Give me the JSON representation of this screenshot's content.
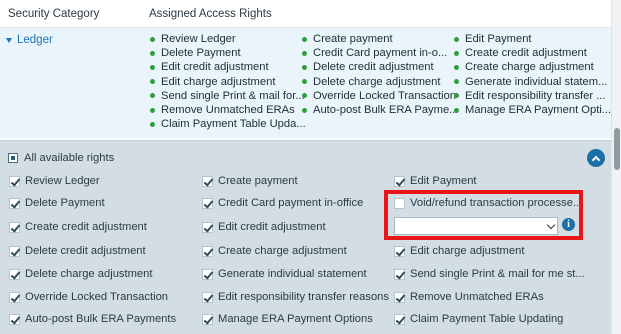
{
  "table": {
    "col_category": "Security Category",
    "col_rights": "Assigned Access Rights"
  },
  "category": {
    "label": "Ledger"
  },
  "assigned": {
    "col1": [
      "Review Ledger",
      "Delete Payment",
      "Edit credit adjustment",
      "Edit charge adjustment",
      "Send single Print & mail for...",
      "Remove Unmatched ERAs",
      "Claim Payment Table Upda..."
    ],
    "col2": [
      "Create payment",
      "Credit Card payment in-o...",
      "Delete credit adjustment",
      "Delete charge adjustment",
      "Override Locked Transaction",
      "Auto-post Bulk ERA Payme..."
    ],
    "col3": [
      "Edit Payment",
      "Create credit adjustment",
      "Create charge adjustment",
      "Generate individual statem...",
      "Edit responsibility transfer ...",
      "Manage ERA Payment Opti..."
    ]
  },
  "panel": {
    "all_rights_label": "All available rights",
    "rights": [
      {
        "label": "Review Ledger",
        "checked": true
      },
      {
        "label": "Create payment",
        "checked": true
      },
      {
        "label": "Edit Payment",
        "checked": true
      },
      {
        "label": "Delete Payment",
        "checked": true
      },
      {
        "label": "Credit Card payment in-office",
        "checked": true
      },
      {
        "label": "Void/refund transaction processe...",
        "checked": false
      },
      {
        "label": "Create credit adjustment",
        "checked": true
      },
      {
        "label": "Edit credit adjustment",
        "checked": true
      },
      {
        "label": "Delete credit adjustment",
        "checked": true
      },
      {
        "label": "Create charge adjustment",
        "checked": true
      },
      {
        "label": "Edit charge adjustment",
        "checked": true
      },
      {
        "label": "Delete charge adjustment",
        "checked": true
      },
      {
        "label": "Generate individual statement",
        "checked": true
      },
      {
        "label": "Send single Print & mail for me st...",
        "checked": true
      },
      {
        "label": "Override Locked Transaction",
        "checked": true
      },
      {
        "label": "Edit responsibility transfer reasons",
        "checked": true
      },
      {
        "label": "Remove Unmatched ERAs",
        "checked": true
      },
      {
        "label": "Auto-post Bulk ERA Payments",
        "checked": true
      },
      {
        "label": "Manage ERA Payment Options",
        "checked": true
      },
      {
        "label": "Claim Payment Table Updating",
        "checked": true
      }
    ],
    "dropdown_value": "",
    "info_icon": "info-icon",
    "collapse_icon": "chevron-up-icon"
  },
  "colors": {
    "accent": "#1a6fa8",
    "category_link": "#1c76b8",
    "bullet": "#2f9e3b",
    "highlight_box": "#e8151b",
    "row_bg": "#e9f5fb",
    "panel_bg": "#d3dde4"
  }
}
